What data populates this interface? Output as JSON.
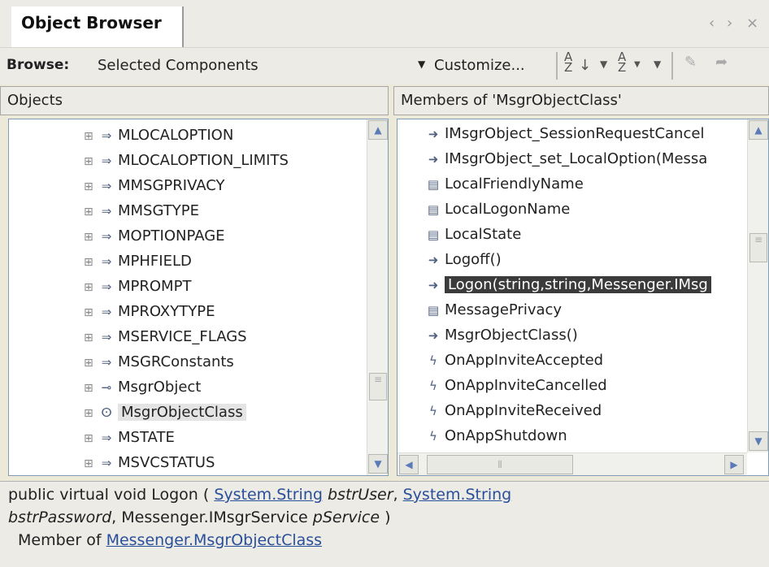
{
  "tab": {
    "title": "Object Browser"
  },
  "window_controls": {
    "prev": "‹",
    "next": "›",
    "close": "×"
  },
  "toolbar": {
    "browse_label": "Browse:",
    "browse_value": "Selected Components",
    "customize_label": "Customize...",
    "sort_az_icon": "sort-alphabetical-icon",
    "group_icon": "group-by-type-icon"
  },
  "objects_pane": {
    "header": "Objects",
    "items": [
      {
        "label": "MLOCALOPTION",
        "icon": "enum-icon"
      },
      {
        "label": "MLOCALOPTION_LIMITS",
        "icon": "enum-icon"
      },
      {
        "label": "MMSGPRIVACY",
        "icon": "enum-icon"
      },
      {
        "label": "MMSGTYPE",
        "icon": "enum-icon"
      },
      {
        "label": "MOPTIONPAGE",
        "icon": "enum-icon"
      },
      {
        "label": "MPHFIELD",
        "icon": "enum-icon"
      },
      {
        "label": "MPROMPT",
        "icon": "enum-icon"
      },
      {
        "label": "MPROXYTYPE",
        "icon": "enum-icon"
      },
      {
        "label": "MSERVICE_FLAGS",
        "icon": "enum-icon"
      },
      {
        "label": "MSGRConstants",
        "icon": "enum-icon"
      },
      {
        "label": "MsgrObject",
        "icon": "interface-icon"
      },
      {
        "label": "MsgrObjectClass",
        "icon": "class-icon"
      },
      {
        "label": "MSTATE",
        "icon": "enum-icon"
      },
      {
        "label": "MSVCSTATUS",
        "icon": "enum-icon"
      }
    ]
  },
  "members_pane": {
    "header": "Members of 'MsgrObjectClass'",
    "items": [
      {
        "label": "IMsgrObject_SessionRequestCancel",
        "icon": "method-icon"
      },
      {
        "label": "IMsgrObject_set_LocalOption(Messa",
        "icon": "method-icon"
      },
      {
        "label": "LocalFriendlyName",
        "icon": "property-icon"
      },
      {
        "label": "LocalLogonName",
        "icon": "property-icon"
      },
      {
        "label": "LocalState",
        "icon": "property-icon"
      },
      {
        "label": "Logoff()",
        "icon": "method-icon"
      },
      {
        "label": "Logon(string,string,Messenger.IMsg",
        "icon": "method-icon"
      },
      {
        "label": "MessagePrivacy",
        "icon": "property-icon"
      },
      {
        "label": "MsgrObjectClass()",
        "icon": "method-icon"
      },
      {
        "label": "OnAppInviteAccepted",
        "icon": "event-icon"
      },
      {
        "label": "OnAppInviteCancelled",
        "icon": "event-icon"
      },
      {
        "label": "OnAppInviteReceived",
        "icon": "event-icon"
      },
      {
        "label": "OnAppShutdown",
        "icon": "event-icon"
      }
    ]
  },
  "description": {
    "sig_prefix": "public virtual void Logon (",
    "type1": "System.String",
    "param1": "bstrUser",
    "comma1": ",",
    "type2": "System.String",
    "param2": "bstrPassword",
    "comma2": ",",
    "type3": "Messenger.IMsgrService",
    "param3": "pService",
    "close": ")",
    "member_of_label": "Member of",
    "member_of_link": "Messenger.MsgrObjectClass"
  }
}
